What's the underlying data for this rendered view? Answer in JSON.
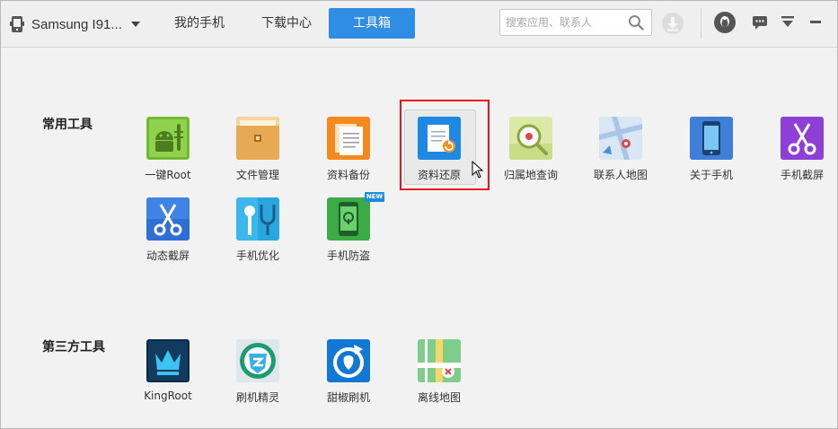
{
  "header": {
    "device_name": "Samsung I91...",
    "tabs": [
      {
        "label": "我的手机"
      },
      {
        "label": "下载中心"
      },
      {
        "label": "工具箱",
        "active": true
      }
    ],
    "search": {
      "value": "",
      "placeholder": "搜索应用、联系人"
    }
  },
  "colors": {
    "accent": "#2f8de4",
    "highlight_border": "#e8161c",
    "new_badge": "#1f8ed8"
  },
  "sections": [
    {
      "title": "常用工具",
      "tools": [
        {
          "label": "一键Root",
          "icon": "android-root-icon"
        },
        {
          "label": "文件管理",
          "icon": "folder-icon"
        },
        {
          "label": "资料备份",
          "icon": "documents-icon"
        },
        {
          "label": "资料还原",
          "icon": "document-restore-icon",
          "selected": true
        },
        {
          "label": "归属地查询",
          "icon": "location-search-icon"
        },
        {
          "label": "联系人地图",
          "icon": "contacts-map-icon"
        },
        {
          "label": "关于手机",
          "icon": "phone-info-icon"
        },
        {
          "label": "手机截屏",
          "icon": "scissors-icon"
        },
        {
          "label": "动态截屏",
          "icon": "scissors-icon"
        },
        {
          "label": "手机优化",
          "icon": "stethoscope-icon"
        },
        {
          "label": "手机防盗",
          "icon": "antitheft-phone-icon",
          "badge": "NEW"
        }
      ]
    },
    {
      "title": "第三方工具",
      "tools": [
        {
          "label": "KingRoot",
          "icon": "kingroot-crown-icon"
        },
        {
          "label": "刷机精灵",
          "icon": "flash-shield-icon"
        },
        {
          "label": "甜椒刷机",
          "icon": "pepper-refresh-icon"
        },
        {
          "label": "离线地图",
          "icon": "offline-map-icon"
        }
      ]
    }
  ]
}
